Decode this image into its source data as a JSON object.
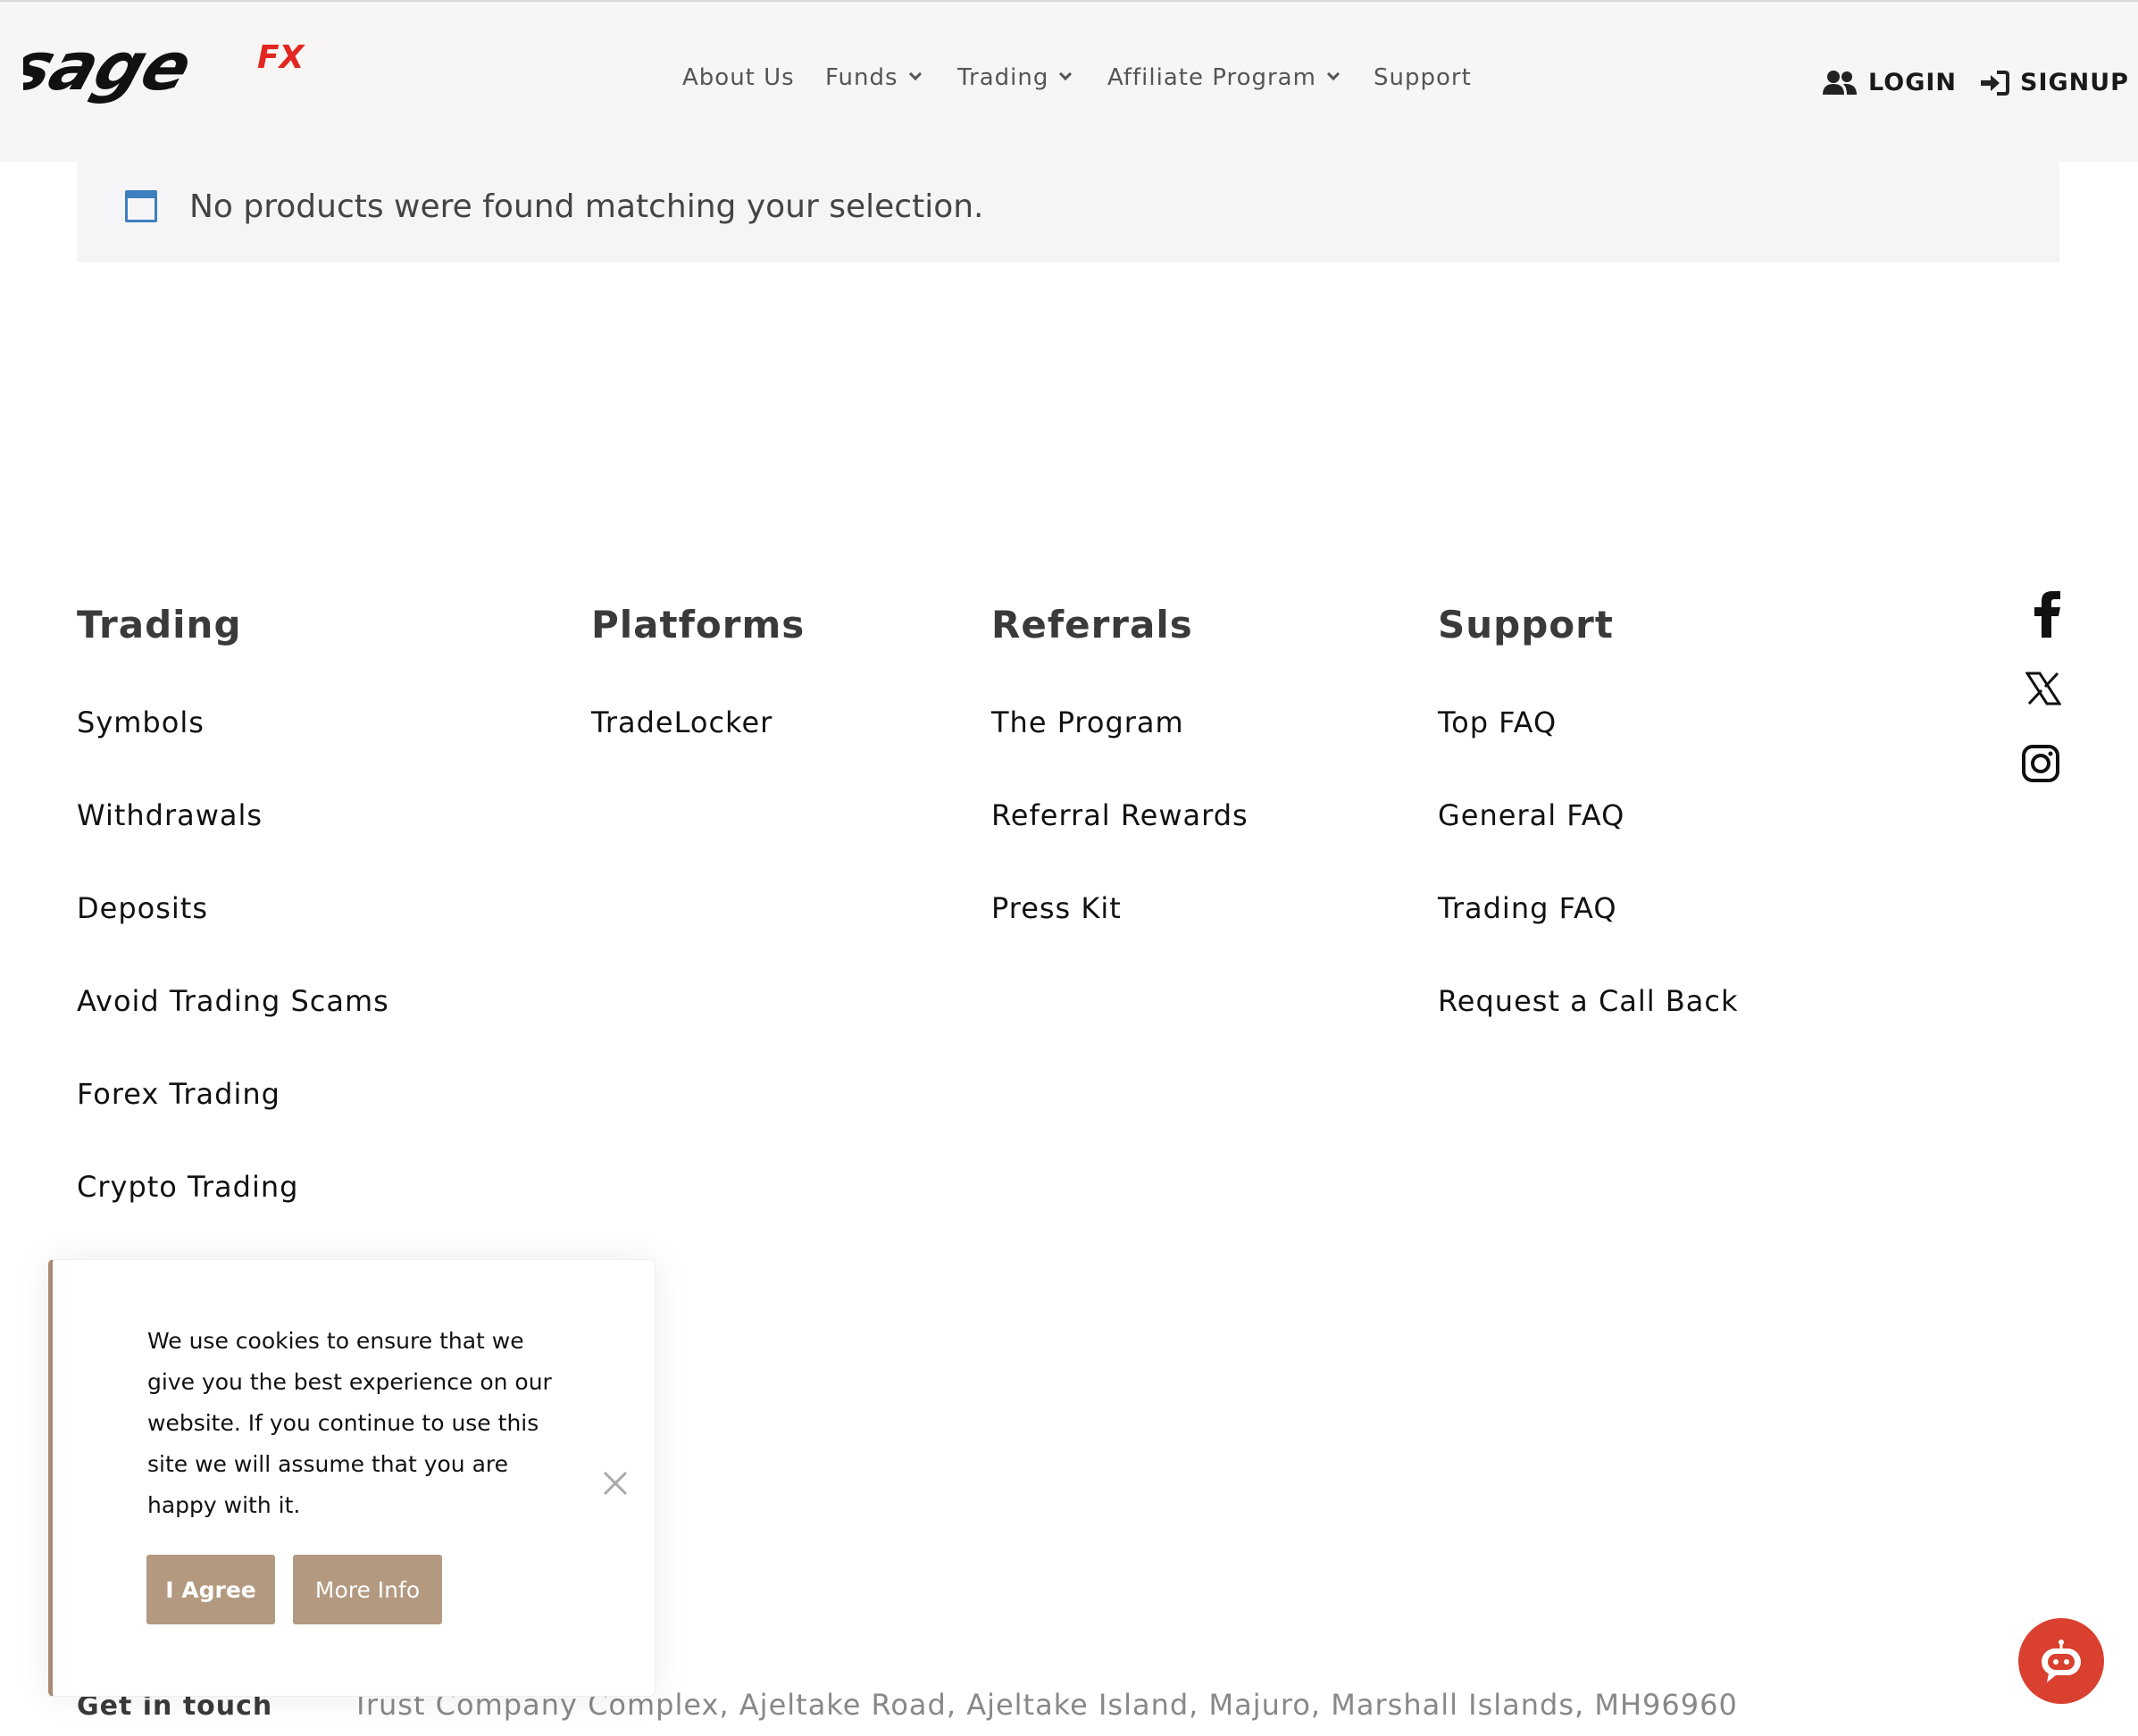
{
  "brand": {
    "logo_text": "sage",
    "logo_accent": "FX",
    "accent_color": "#e1271f"
  },
  "nav": {
    "items": [
      {
        "label": "About Us",
        "has_dropdown": false
      },
      {
        "label": "Funds",
        "has_dropdown": true
      },
      {
        "label": "Trading",
        "has_dropdown": true
      },
      {
        "label": "Affiliate Program",
        "has_dropdown": true
      },
      {
        "label": "Support",
        "has_dropdown": false
      }
    ],
    "login": "LOGIN",
    "signup": "SIGNUP"
  },
  "notice": {
    "text": "No products were found matching your selection."
  },
  "footer": {
    "columns": [
      {
        "title": "Trading",
        "links": [
          "Symbols",
          "Withdrawals",
          "Deposits",
          "Avoid Trading Scams",
          "Forex Trading",
          "Crypto Trading"
        ]
      },
      {
        "title": "Platforms",
        "links": [
          "TradeLocker"
        ]
      },
      {
        "title": "Referrals",
        "links": [
          "The Program",
          "Referral Rewards",
          "Press Kit"
        ]
      },
      {
        "title": "Support",
        "links": [
          "Top FAQ",
          "General FAQ",
          "Trading FAQ",
          "Request a Call Back"
        ]
      }
    ],
    "social": [
      "facebook-icon",
      "x-icon",
      "instagram-icon"
    ],
    "get_in_touch": "Get in touch",
    "address": "Trust Company Complex, Ajeltake Road, Ajeltake Island, Majuro, Marshall Islands, MH96960"
  },
  "cookie": {
    "text": "We use cookies to ensure that we give you the best experience on our website. If you continue to use this site we will assume that you are happy with it.",
    "agree": "I Agree",
    "more": "More Info",
    "button_color": "#b39980"
  },
  "chat": {
    "icon": "chatbot-icon",
    "color": "#d9402f"
  }
}
